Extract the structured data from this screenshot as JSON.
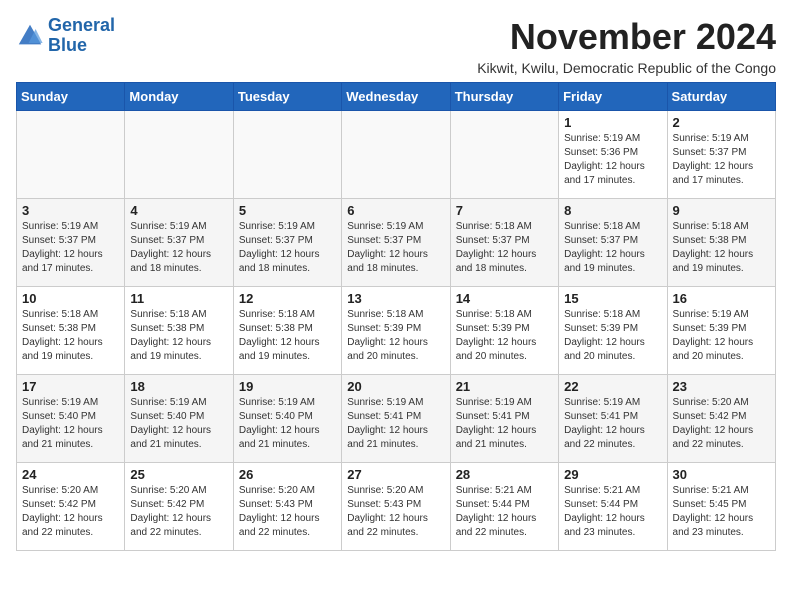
{
  "logo": {
    "line1": "General",
    "line2": "Blue"
  },
  "title": "November 2024",
  "subtitle": "Kikwit, Kwilu, Democratic Republic of the Congo",
  "weekdays": [
    "Sunday",
    "Monday",
    "Tuesday",
    "Wednesday",
    "Thursday",
    "Friday",
    "Saturday"
  ],
  "weeks": [
    [
      {
        "day": "",
        "info": ""
      },
      {
        "day": "",
        "info": ""
      },
      {
        "day": "",
        "info": ""
      },
      {
        "day": "",
        "info": ""
      },
      {
        "day": "",
        "info": ""
      },
      {
        "day": "1",
        "info": "Sunrise: 5:19 AM\nSunset: 5:36 PM\nDaylight: 12 hours\nand 17 minutes."
      },
      {
        "day": "2",
        "info": "Sunrise: 5:19 AM\nSunset: 5:37 PM\nDaylight: 12 hours\nand 17 minutes."
      }
    ],
    [
      {
        "day": "3",
        "info": "Sunrise: 5:19 AM\nSunset: 5:37 PM\nDaylight: 12 hours\nand 17 minutes."
      },
      {
        "day": "4",
        "info": "Sunrise: 5:19 AM\nSunset: 5:37 PM\nDaylight: 12 hours\nand 18 minutes."
      },
      {
        "day": "5",
        "info": "Sunrise: 5:19 AM\nSunset: 5:37 PM\nDaylight: 12 hours\nand 18 minutes."
      },
      {
        "day": "6",
        "info": "Sunrise: 5:19 AM\nSunset: 5:37 PM\nDaylight: 12 hours\nand 18 minutes."
      },
      {
        "day": "7",
        "info": "Sunrise: 5:18 AM\nSunset: 5:37 PM\nDaylight: 12 hours\nand 18 minutes."
      },
      {
        "day": "8",
        "info": "Sunrise: 5:18 AM\nSunset: 5:37 PM\nDaylight: 12 hours\nand 19 minutes."
      },
      {
        "day": "9",
        "info": "Sunrise: 5:18 AM\nSunset: 5:38 PM\nDaylight: 12 hours\nand 19 minutes."
      }
    ],
    [
      {
        "day": "10",
        "info": "Sunrise: 5:18 AM\nSunset: 5:38 PM\nDaylight: 12 hours\nand 19 minutes."
      },
      {
        "day": "11",
        "info": "Sunrise: 5:18 AM\nSunset: 5:38 PM\nDaylight: 12 hours\nand 19 minutes."
      },
      {
        "day": "12",
        "info": "Sunrise: 5:18 AM\nSunset: 5:38 PM\nDaylight: 12 hours\nand 19 minutes."
      },
      {
        "day": "13",
        "info": "Sunrise: 5:18 AM\nSunset: 5:39 PM\nDaylight: 12 hours\nand 20 minutes."
      },
      {
        "day": "14",
        "info": "Sunrise: 5:18 AM\nSunset: 5:39 PM\nDaylight: 12 hours\nand 20 minutes."
      },
      {
        "day": "15",
        "info": "Sunrise: 5:18 AM\nSunset: 5:39 PM\nDaylight: 12 hours\nand 20 minutes."
      },
      {
        "day": "16",
        "info": "Sunrise: 5:19 AM\nSunset: 5:39 PM\nDaylight: 12 hours\nand 20 minutes."
      }
    ],
    [
      {
        "day": "17",
        "info": "Sunrise: 5:19 AM\nSunset: 5:40 PM\nDaylight: 12 hours\nand 21 minutes."
      },
      {
        "day": "18",
        "info": "Sunrise: 5:19 AM\nSunset: 5:40 PM\nDaylight: 12 hours\nand 21 minutes."
      },
      {
        "day": "19",
        "info": "Sunrise: 5:19 AM\nSunset: 5:40 PM\nDaylight: 12 hours\nand 21 minutes."
      },
      {
        "day": "20",
        "info": "Sunrise: 5:19 AM\nSunset: 5:41 PM\nDaylight: 12 hours\nand 21 minutes."
      },
      {
        "day": "21",
        "info": "Sunrise: 5:19 AM\nSunset: 5:41 PM\nDaylight: 12 hours\nand 21 minutes."
      },
      {
        "day": "22",
        "info": "Sunrise: 5:19 AM\nSunset: 5:41 PM\nDaylight: 12 hours\nand 22 minutes."
      },
      {
        "day": "23",
        "info": "Sunrise: 5:20 AM\nSunset: 5:42 PM\nDaylight: 12 hours\nand 22 minutes."
      }
    ],
    [
      {
        "day": "24",
        "info": "Sunrise: 5:20 AM\nSunset: 5:42 PM\nDaylight: 12 hours\nand 22 minutes."
      },
      {
        "day": "25",
        "info": "Sunrise: 5:20 AM\nSunset: 5:42 PM\nDaylight: 12 hours\nand 22 minutes."
      },
      {
        "day": "26",
        "info": "Sunrise: 5:20 AM\nSunset: 5:43 PM\nDaylight: 12 hours\nand 22 minutes."
      },
      {
        "day": "27",
        "info": "Sunrise: 5:20 AM\nSunset: 5:43 PM\nDaylight: 12 hours\nand 22 minutes."
      },
      {
        "day": "28",
        "info": "Sunrise: 5:21 AM\nSunset: 5:44 PM\nDaylight: 12 hours\nand 22 minutes."
      },
      {
        "day": "29",
        "info": "Sunrise: 5:21 AM\nSunset: 5:44 PM\nDaylight: 12 hours\nand 23 minutes."
      },
      {
        "day": "30",
        "info": "Sunrise: 5:21 AM\nSunset: 5:45 PM\nDaylight: 12 hours\nand 23 minutes."
      }
    ]
  ]
}
